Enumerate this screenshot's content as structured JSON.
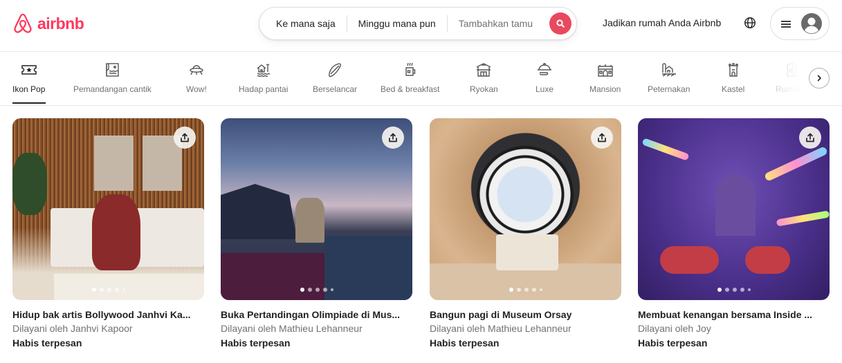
{
  "header": {
    "logo_text": "airbnb",
    "brand_color": "#ff385c",
    "search": {
      "location": "Ke mana saja",
      "dates": "Minggu mana pun",
      "guests_placeholder": "Tambahkan tamu",
      "search_icon": "search-icon"
    },
    "host_link": "Jadikan rumah Anda Airbnb",
    "globe_icon": "globe-icon",
    "menu_icon": "hamburger-icon",
    "avatar_icon": "user-avatar-icon"
  },
  "categories": {
    "active_index": 0,
    "items": [
      {
        "label": "Ikon Pop",
        "icon": "ticket-star-icon"
      },
      {
        "label": "Pemandangan cantik",
        "icon": "view-frame-icon"
      },
      {
        "label": "Wow!",
        "icon": "ufo-icon"
      },
      {
        "label": "Hadap pantai",
        "icon": "beach-hut-icon"
      },
      {
        "label": "Berselancar",
        "icon": "surfboard-icon"
      },
      {
        "label": "Bed & breakfast",
        "icon": "mug-icon"
      },
      {
        "label": "Ryokan",
        "icon": "ryokan-icon"
      },
      {
        "label": "Luxe",
        "icon": "cloche-icon"
      },
      {
        "label": "Mansion",
        "icon": "mansion-icon"
      },
      {
        "label": "Peternakan",
        "icon": "farm-icon"
      },
      {
        "label": "Kastel",
        "icon": "castle-icon"
      },
      {
        "label": "Rumah k",
        "icon": "house-icon"
      }
    ],
    "next_icon": "chevron-right-icon"
  },
  "listings": [
    {
      "title": "Hidup bak artis Bollywood Janhvi Ka...",
      "host": "Dilayani oleh Janhvi Kapoor",
      "status": "Habis terpesan",
      "photo_count": 5,
      "active_photo": 1
    },
    {
      "title": "Buka Pertandingan Olimpiade di Mus...",
      "host": "Dilayani oleh Mathieu Lehanneur",
      "status": "Habis terpesan",
      "photo_count": 5,
      "active_photo": 1
    },
    {
      "title": "Bangun pagi di Museum Orsay",
      "host": "Dilayani oleh Mathieu Lehanneur",
      "status": "Habis terpesan",
      "photo_count": 5,
      "active_photo": 1
    },
    {
      "title": "Membuat kenangan bersama Inside ...",
      "host": "Dilayani oleh Joy",
      "status": "Habis terpesan",
      "photo_count": 5,
      "active_photo": 1
    }
  ]
}
